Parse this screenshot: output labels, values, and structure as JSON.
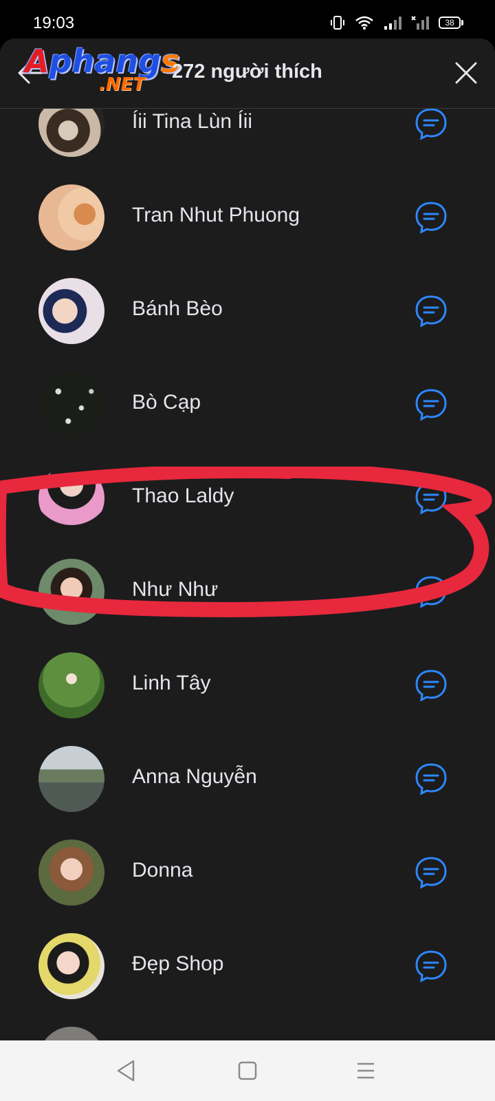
{
  "status_bar": {
    "time": "19:03",
    "battery_level": "38",
    "icons": [
      "vibrate-icon",
      "wifi-icon",
      "signal-icon",
      "signal-off-icon",
      "battery-icon"
    ]
  },
  "header": {
    "title": "272 người thích",
    "logo_main_red": "A",
    "logo_main_blue": "phang",
    "logo_main_orange": "s",
    "logo_suffix": ".NET"
  },
  "people": [
    {
      "name": "Íii Tina Lùn Íii"
    },
    {
      "name": "Tran Nhut Phuong"
    },
    {
      "name": "Bánh Bèo"
    },
    {
      "name": "Bò Cạp"
    },
    {
      "name": "Thao Laldy"
    },
    {
      "name": "Như Như"
    },
    {
      "name": "Linh Tây"
    },
    {
      "name": "Anna Nguyễn"
    },
    {
      "name": "Donna"
    },
    {
      "name": "Đẹp Shop"
    }
  ],
  "colors": {
    "background": "#1c1c1d",
    "accent": "#2d88ff",
    "highlight_marker": "#e8283d",
    "text": "#e4e6eb"
  },
  "nav_bar": {
    "buttons": [
      "back-triangle-icon",
      "home-square-icon",
      "menu-lines-icon"
    ]
  }
}
